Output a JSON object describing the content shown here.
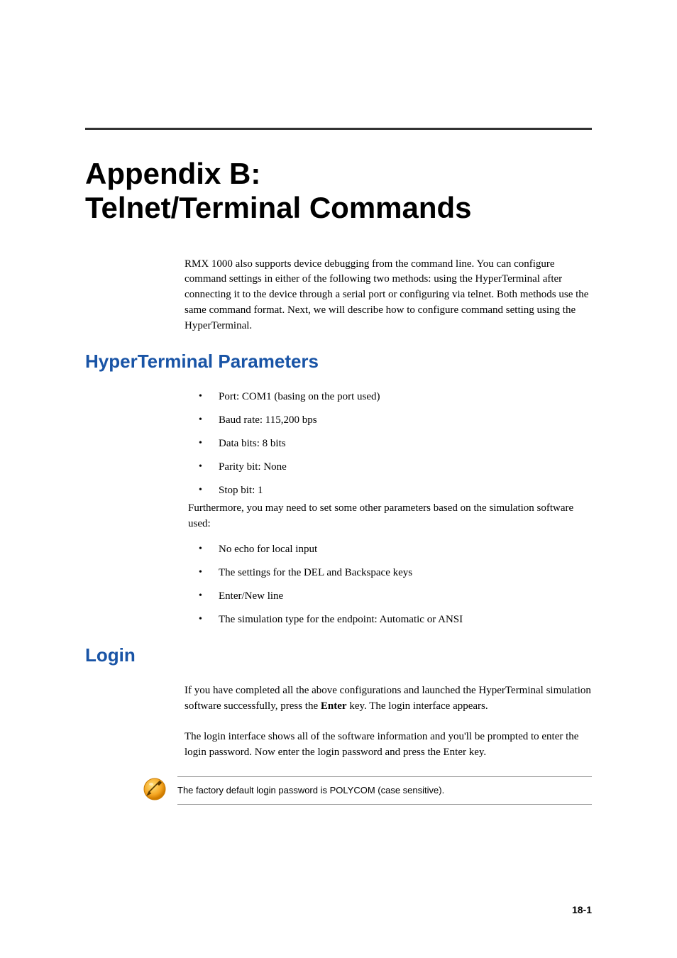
{
  "title_line1": "Appendix B:",
  "title_line2": "Telnet/Terminal Commands",
  "intro": "RMX 1000 also supports device debugging from the command line. You can configure command settings in either of the following two methods: using the HyperTerminal after connecting it to the device through a serial port or configuring via telnet. Both methods use the same command format. Next, we will describe how to configure command setting using the HyperTerminal.",
  "section1_heading": "HyperTerminal Parameters",
  "section1_bullets": [
    "Port: COM1 (basing on the port used)",
    "Baud rate: 115,200 bps",
    "Data bits: 8 bits",
    "Parity bit: None",
    "Stop bit: 1"
  ],
  "sim_note": "Furthermore, you may need to set some other parameters based on the simulation software used:",
  "section1_bullets2": [
    "No echo for local input",
    "The settings for the DEL and Backspace keys",
    "Enter/New line",
    "The simulation type for the endpoint: Automatic or ANSI"
  ],
  "section2_heading": "Login",
  "login_para1_pre": "If you have completed all the above configurations and launched the HyperTerminal simulation software successfully, press the ",
  "login_para1_bold": "Enter",
  "login_para1_post": " key. The login interface appears.",
  "login_para2": "The login interface shows all of the software information and you'll be prompted to enter the login password. Now enter the login password and press the Enter key.",
  "note_text": "The factory default login password is POLYCOM (case sensitive).",
  "page_number": "18-1"
}
